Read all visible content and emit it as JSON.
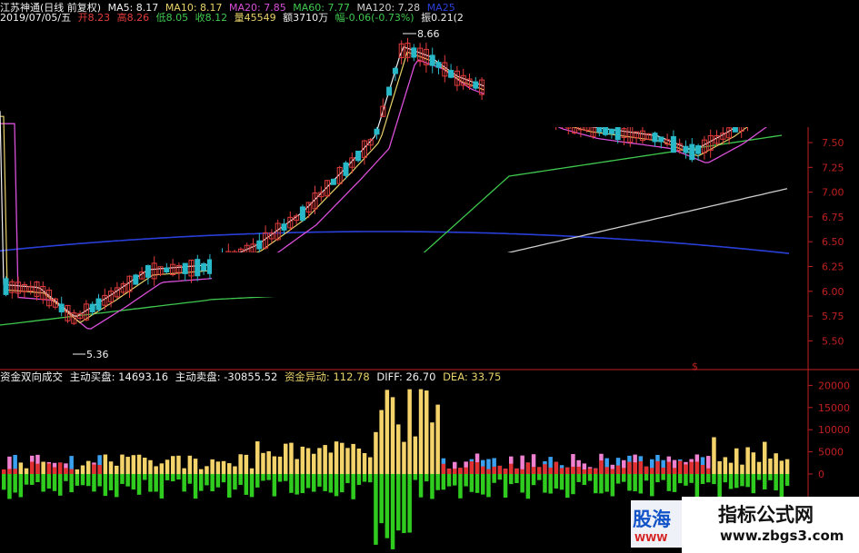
{
  "header1": {
    "name": "江苏神通(日线 前复权)",
    "ma5": "MA5: 8.17",
    "ma10": "MA10: 8.17",
    "ma20": "MA20: 7.85",
    "ma60": "MA60: 7.77",
    "ma120": "MA120: 7.28",
    "ma250": "MA25"
  },
  "header2": {
    "date": "2019/07/05/五",
    "open": "开8.23",
    "high": "高8.26",
    "low": "低8.05",
    "close": "收8.12",
    "volume": "量45549",
    "amount": "额3710万",
    "change": "幅-0.06(-0.73%)",
    "amplitude": "振0.21(2"
  },
  "indicator": {
    "name": "资金双向成交",
    "buy": "主动买盘: 14693.16",
    "sell": "主动卖盘: -30855.52",
    "anomaly": "资金异动: 112.78",
    "diff": "DIFF: 26.70",
    "dea": "DEA: 33.75"
  },
  "price_axis": [
    "7.50",
    "7.25",
    "7.00",
    "6.75",
    "6.50",
    "6.25",
    "6.00",
    "5.75",
    "5.50"
  ],
  "indicator_axis": [
    "20000",
    "15000",
    "10000",
    "5000",
    "0"
  ],
  "axis_marker": "$",
  "annotations": {
    "high_label": "8.66",
    "low_label": "5.36"
  },
  "colors": {
    "up": "#e23c3c",
    "down": "#29b8c8",
    "ma5": "#f0f0f0",
    "ma10": "#e8d26a",
    "ma20": "#d84fd8",
    "ma60": "#3fc84f",
    "ma120": "#cfcfcf",
    "ma250": "#2a3fd8",
    "buy_bar": "#f5d36b",
    "sell_bar": "#2fcc1f",
    "axis": "#c02020"
  },
  "watermarks": {
    "left_logo": "股海",
    "left_sub": "WWW",
    "right_title": "指标公式网",
    "right_url": "www.zbgs3.com"
  }
}
